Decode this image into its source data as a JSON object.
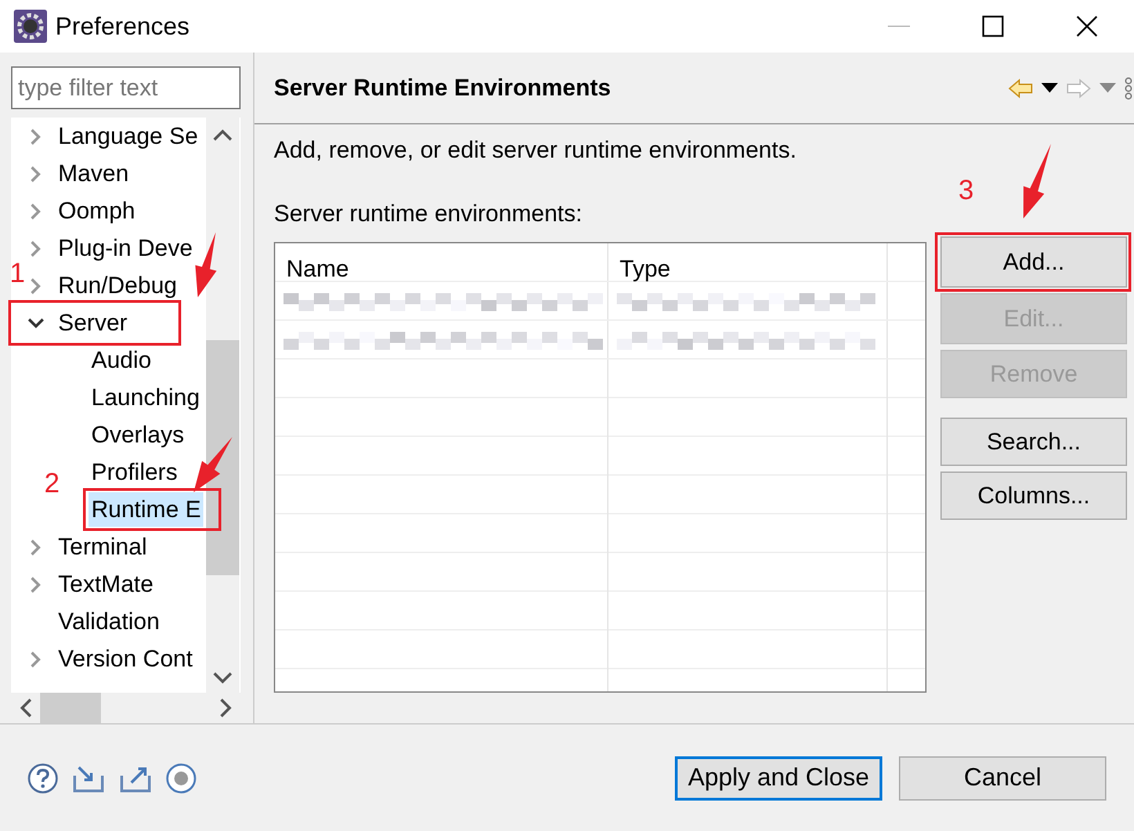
{
  "window": {
    "title": "Preferences"
  },
  "filter": {
    "placeholder": "type filter text"
  },
  "tree": [
    {
      "label": "Language Se",
      "kind": "folder",
      "expanded": false,
      "selected": false
    },
    {
      "label": "Maven",
      "kind": "folder",
      "expanded": false,
      "selected": false
    },
    {
      "label": "Oomph",
      "kind": "folder",
      "expanded": false,
      "selected": false
    },
    {
      "label": "Plug-in Deve",
      "kind": "folder",
      "expanded": false,
      "selected": false
    },
    {
      "label": "Run/Debug",
      "kind": "folder",
      "expanded": false,
      "selected": false
    },
    {
      "label": "Server",
      "kind": "folder",
      "expanded": true,
      "selected": false,
      "children": [
        {
          "label": "Audio",
          "kind": "leaf",
          "selected": false
        },
        {
          "label": "Launching",
          "kind": "leaf",
          "selected": false
        },
        {
          "label": "Overlays",
          "kind": "leaf",
          "selected": false
        },
        {
          "label": "Profilers",
          "kind": "leaf",
          "selected": false
        },
        {
          "label": "Runtime E",
          "kind": "leaf",
          "selected": true
        }
      ]
    },
    {
      "label": "Terminal",
      "kind": "folder",
      "expanded": false,
      "selected": false
    },
    {
      "label": "TextMate",
      "kind": "folder",
      "expanded": false,
      "selected": false
    },
    {
      "label": "Validation",
      "kind": "leaf",
      "selected": false
    },
    {
      "label": "Version Cont",
      "kind": "folder",
      "expanded": false,
      "selected": false
    }
  ],
  "page": {
    "title": "Server Runtime Environments",
    "description": "Add, remove, or edit server runtime environments.",
    "table_label": "Server runtime environments:"
  },
  "table": {
    "columns": [
      "Name",
      "Type"
    ],
    "rows": [
      {
        "kind": "blurred"
      },
      {
        "kind": "blurred"
      }
    ]
  },
  "side_buttons": [
    {
      "label": "Add...",
      "disabled": false
    },
    {
      "label": "Edit...",
      "disabled": true
    },
    {
      "label": "Remove",
      "disabled": true
    },
    {
      "label": "Search...",
      "disabled": false
    },
    {
      "label": "Columns...",
      "disabled": false
    }
  ],
  "footer_buttons": [
    {
      "label": "Apply and Close",
      "default": true
    },
    {
      "label": "Cancel",
      "default": false
    }
  ],
  "annotations": [
    {
      "number": "1"
    },
    {
      "number": "2"
    },
    {
      "number": "3"
    }
  ]
}
